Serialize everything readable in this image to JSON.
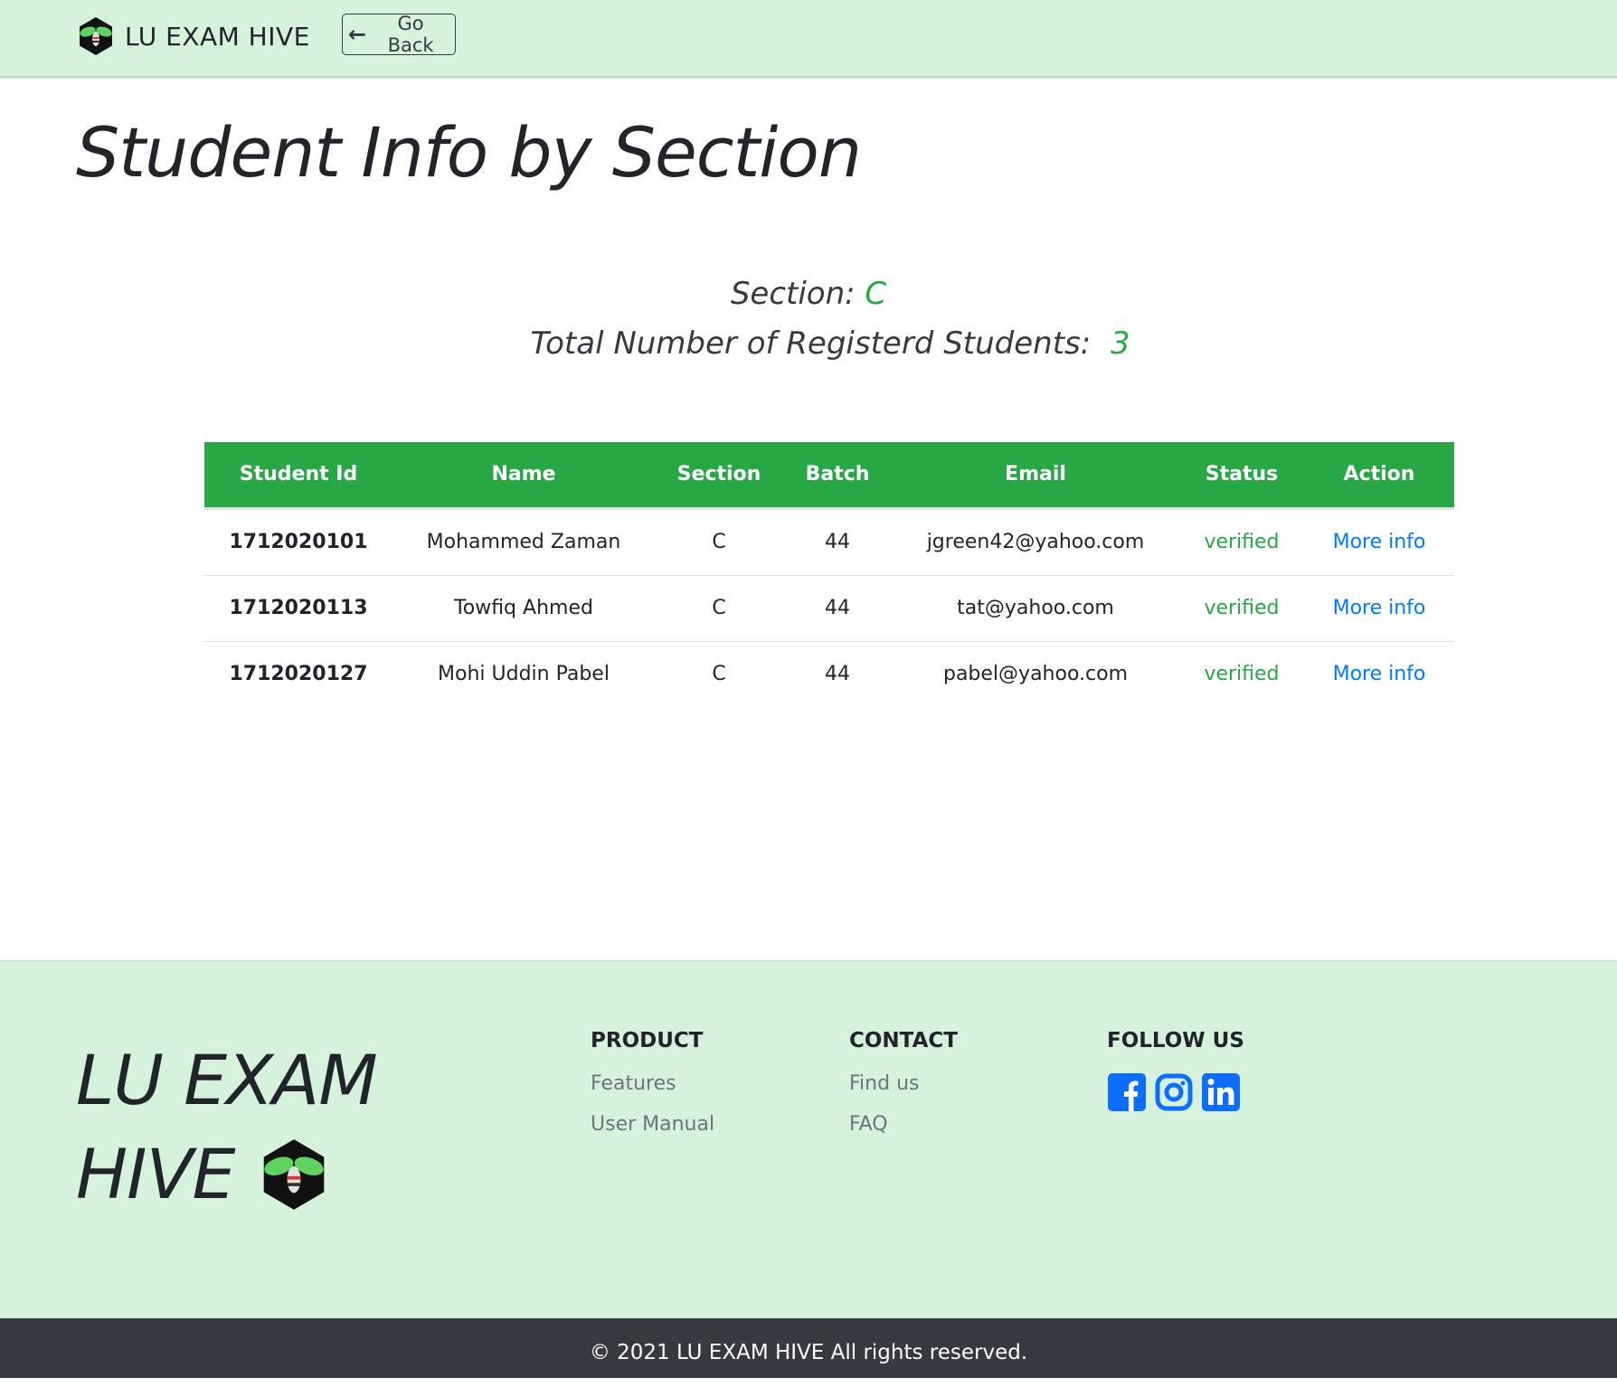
{
  "navbar": {
    "brand": "LU EXAM HIVE",
    "go_back_label": "Go Back",
    "go_back_icon": "arrow-left-icon"
  },
  "main": {
    "title": "Student Info by Section",
    "section_label": "Section:",
    "section_value": "C",
    "count_label": "Total Number of Registerd Students:",
    "count_value": "3"
  },
  "table": {
    "headers": [
      "Student Id",
      "Name",
      "Section",
      "Batch",
      "Email",
      "Status",
      "Action"
    ],
    "rows": [
      {
        "id": "1712020101",
        "name": "Mohammed Zaman",
        "section": "C",
        "batch": "44",
        "email": "jgreen42@yahoo.com",
        "status": "verified",
        "action": "More info"
      },
      {
        "id": "1712020113",
        "name": "Towfiq Ahmed",
        "section": "C",
        "batch": "44",
        "email": "tat@yahoo.com",
        "status": "verified",
        "action": "More info"
      },
      {
        "id": "1712020127",
        "name": "Mohi Uddin Pabel",
        "section": "C",
        "batch": "44",
        "email": "pabel@yahoo.com",
        "status": "verified",
        "action": "More info"
      }
    ]
  },
  "footer": {
    "brand_line1": "LU EXAM",
    "brand_line2": "HIVE",
    "product": {
      "heading": "PRODUCT",
      "links": [
        "Features",
        "User Manual"
      ]
    },
    "contact": {
      "heading": "CONTACT",
      "links": [
        "Find us",
        "FAQ"
      ]
    },
    "follow": {
      "heading": "FOLLOW US",
      "icons": [
        "facebook-icon",
        "instagram-icon",
        "linkedin-icon"
      ]
    },
    "copyright": "© 2021 LU EXAM HIVE All rights reserved."
  },
  "colors": {
    "accent_green": "#28a745",
    "nav_bg": "#d7f2da",
    "link_blue": "#007bff",
    "social_blue": "#0d6efd",
    "bottom_bar": "#343a40"
  }
}
